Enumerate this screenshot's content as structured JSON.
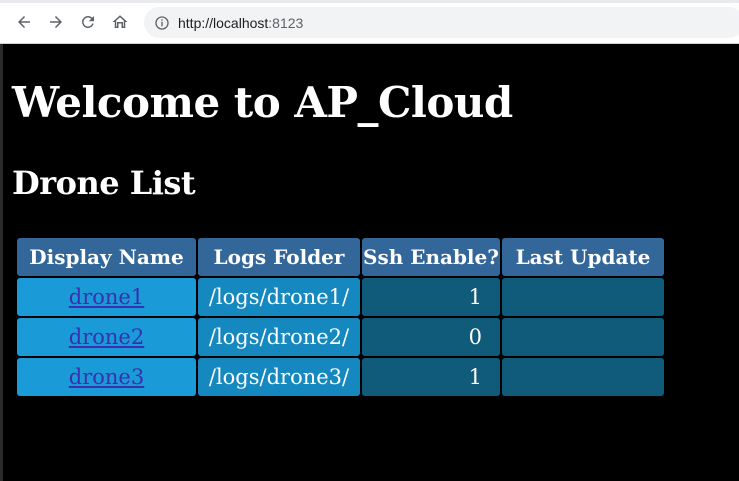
{
  "browser": {
    "url_host": "http://localhost",
    "url_port": ":8123"
  },
  "page": {
    "title": "Welcome to AP_Cloud",
    "section_title": "Drone List"
  },
  "table": {
    "headers": [
      "Display Name",
      "Logs Folder",
      "Ssh Enable?",
      "Last Update"
    ],
    "rows": [
      {
        "name": "drone1",
        "folder": "/logs/drone1/",
        "ssh": "1",
        "last_update": ""
      },
      {
        "name": "drone2",
        "folder": "/logs/drone2/",
        "ssh": "0",
        "last_update": ""
      },
      {
        "name": "drone3",
        "folder": "/logs/drone3/",
        "ssh": "1",
        "last_update": ""
      }
    ]
  },
  "colors": {
    "header_bg": "#336699",
    "name_cell_bg": "#1a9ad6",
    "folder_cell_bg": "#1688c0",
    "ssh_cell_bg": "#105a7a",
    "link_color": "#3a2fb0"
  }
}
